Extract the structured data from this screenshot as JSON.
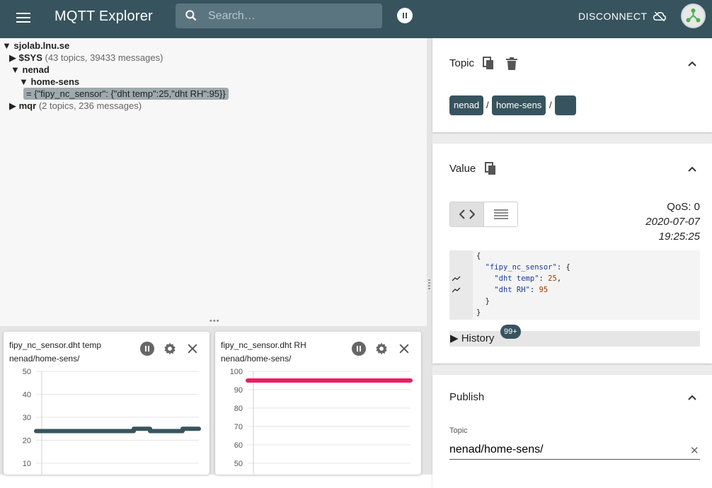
{
  "app": {
    "title": "MQTT Explorer"
  },
  "search": {
    "placeholder": "Search…"
  },
  "header": {
    "disconnect_label": "DISCONNECT"
  },
  "tree": {
    "root": {
      "arrow": "▼",
      "label": "sjolab.lnu.se"
    },
    "sys": {
      "arrow": "▶",
      "label": "$SYS",
      "meta": "(43 topics, 39433 messages)"
    },
    "nenad": {
      "arrow": "▼",
      "label": "nenad"
    },
    "home_sens": {
      "arrow": "▼",
      "label": "home-sens"
    },
    "value": "= {\"fipy_nc_sensor\": {\"dht temp\":25,\"dht RH\":95}}",
    "mqr": {
      "arrow": "▶",
      "label": "mqr",
      "meta": "(2 topics, 236 messages)"
    }
  },
  "charts": [
    {
      "title": "fipy_nc_sensor.dht temp",
      "topic": "nenad/home-sens/"
    },
    {
      "title": "fipy_nc_sensor.dht RH",
      "topic": "nenad/home-sens/"
    }
  ],
  "chart_data": [
    {
      "type": "line",
      "title": "fipy_nc_sensor.dht temp",
      "ylim": [
        10,
        50
      ],
      "yticks": [
        50,
        40,
        30,
        20,
        10
      ],
      "series": [
        {
          "values": [
            24,
            24,
            24,
            24,
            24,
            24,
            25,
            24,
            24,
            25,
            25
          ]
        }
      ],
      "color": "#37545e"
    },
    {
      "type": "line",
      "title": "fipy_nc_sensor.dht RH",
      "ylim": [
        50,
        100
      ],
      "yticks": [
        100,
        90,
        80,
        70,
        60,
        50
      ],
      "series": [
        {
          "values": [
            95,
            95,
            95,
            95,
            95,
            95,
            95,
            95,
            95,
            95,
            95
          ]
        }
      ],
      "color": "#e91e63"
    }
  ],
  "topic_section": {
    "title": "Topic",
    "chips": [
      "nenad",
      "home-sens",
      ""
    ],
    "separator": "/"
  },
  "value_section": {
    "title": "Value",
    "qos": "QoS: 0",
    "date": "2020-07-07",
    "time": "19:25:25",
    "history_label": "▶ History",
    "history_badge": "99+"
  },
  "publish_section": {
    "title": "Publish",
    "topic_label": "Topic",
    "topic_value": "nenad/home-sens/"
  }
}
